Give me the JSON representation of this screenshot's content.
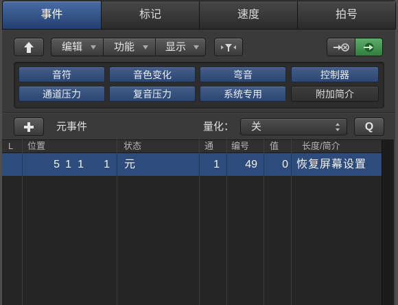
{
  "tabs": [
    {
      "label": "事件",
      "selected": true
    },
    {
      "label": "标记",
      "selected": false
    },
    {
      "label": "速度",
      "selected": false
    },
    {
      "label": "拍号",
      "selected": false
    }
  ],
  "toolbar": {
    "up_icon": "up-arrow-icon",
    "menus": [
      {
        "label": "编辑",
        "icon": "chevron-down-icon"
      },
      {
        "label": "功能",
        "icon": "chevron-down-icon"
      },
      {
        "label": "显示",
        "icon": "chevron-down-icon"
      }
    ],
    "filter_icon": "filter-icon",
    "midi_out_icon": "midi-out-icon",
    "midi_in_icon": "midi-in-icon",
    "midi_in_active": true
  },
  "filters": [
    {
      "label": "音符",
      "active": true
    },
    {
      "label": "音色变化",
      "active": true
    },
    {
      "label": "弯音",
      "active": true
    },
    {
      "label": "控制器",
      "active": true
    },
    {
      "label": "通道压力",
      "active": true
    },
    {
      "label": "复音压力",
      "active": true
    },
    {
      "label": "系统专用",
      "active": true
    },
    {
      "label": "附加简介",
      "active": false
    }
  ],
  "event_bar": {
    "add_icon": "plus-icon",
    "create_type": "元事件",
    "quantize_label": "量化：",
    "quantize_value": "关",
    "quantize_icon": "up-down-arrows-icon",
    "q_label": "Q"
  },
  "table": {
    "columns": {
      "l": "L",
      "position": "位置",
      "status": "状态",
      "channel": "通",
      "number": "编号",
      "value": "值",
      "length_info": "长度/简介"
    },
    "rows": [
      {
        "position": [
          "5",
          "1",
          "1",
          "1"
        ],
        "status": "元",
        "channel": "1",
        "number": "49",
        "value": "0",
        "length_info": "恢复屏幕设置",
        "selected": true
      }
    ]
  },
  "colors": {
    "accent": "#2d4b7b",
    "filter_active": "#2f4c7c",
    "midi_in_active": "#3a9a4a",
    "background": "#3a3a3a",
    "table_background": "#252525"
  }
}
